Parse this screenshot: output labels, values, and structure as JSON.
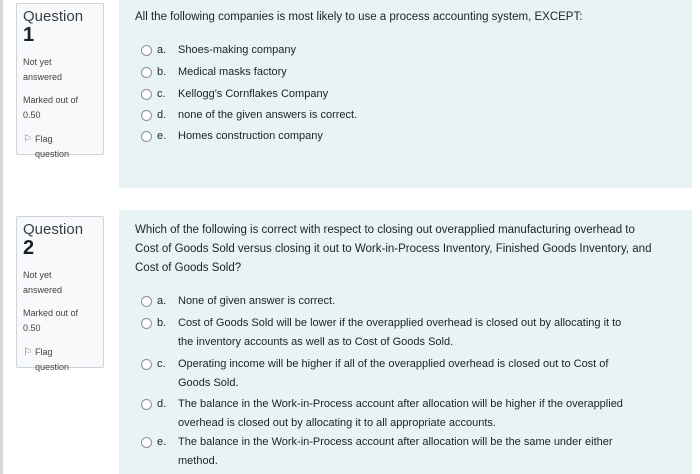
{
  "questions": [
    {
      "label": "Question",
      "number": "1",
      "state_line1": "Not yet",
      "state_line2": "answered",
      "mark_line1": "Marked out of",
      "mark_line2": "0.50",
      "flag_line1": "Flag",
      "flag_line2": "question",
      "text": "All the following companies is most likely to use a process accounting system, EXCEPT:",
      "options": [
        {
          "letter": "a.",
          "text": "Shoes-making company"
        },
        {
          "letter": "b.",
          "text": "Medical masks factory"
        },
        {
          "letter": "c.",
          "text": "Kellogg's Cornflakes Company"
        },
        {
          "letter": "d.",
          "text": "none of the given answers is correct."
        },
        {
          "letter": "e.",
          "text": "Homes construction company"
        }
      ]
    },
    {
      "label": "Question",
      "number": "2",
      "state_line1": "Not yet",
      "state_line2": "answered",
      "mark_line1": "Marked out of",
      "mark_line2": "0.50",
      "flag_line1": "Flag",
      "flag_line2": "question",
      "text_lines": [
        "Which of the following is correct with respect to closing out overapplied manufacturing overhead to",
        "Cost of Goods Sold versus closing it out to Work-in-Process Inventory, Finished Goods Inventory, and",
        "Cost of Goods Sold?"
      ],
      "options": [
        {
          "letter": "a.",
          "lines": [
            "None of given answer is correct."
          ]
        },
        {
          "letter": "b.",
          "lines": [
            "Cost of Goods Sold will be lower if the overapplied overhead is closed out by allocating it to",
            "the inventory accounts as well as to Cost of Goods Sold."
          ]
        },
        {
          "letter": "c.",
          "lines": [
            "Operating income will be higher if all of the overapplied overhead is closed out to Cost of",
            "Goods Sold."
          ]
        },
        {
          "letter": "d.",
          "lines": [
            "The balance in the Work-in-Process account after allocation will be higher if the overapplied",
            "overhead is closed out by allocating it to all appropriate accounts."
          ]
        },
        {
          "letter": "e.",
          "lines": [
            "The balance in the Work-in-Process account after allocation will be the same under either",
            "method."
          ]
        }
      ]
    }
  ]
}
